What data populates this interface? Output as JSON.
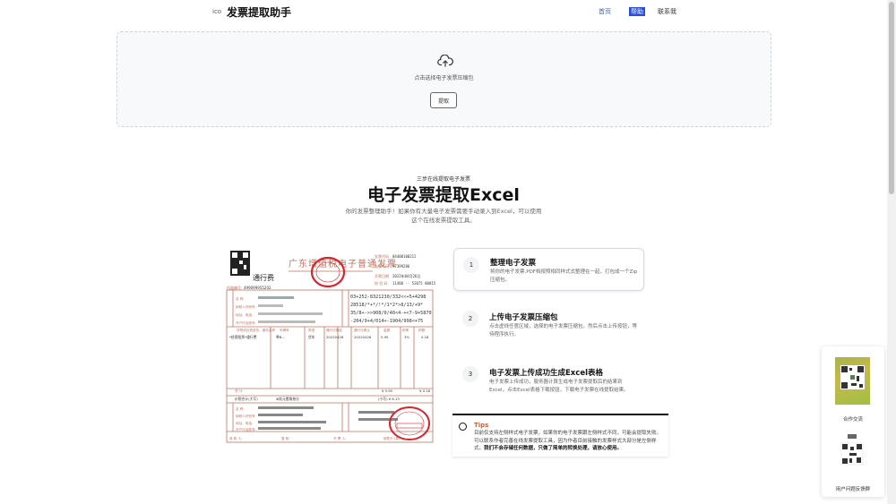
{
  "header": {
    "logo_icon": "ico",
    "title": "发票提取助手",
    "nav": [
      {
        "label": "首页"
      },
      {
        "label": "帮助"
      },
      {
        "label": "联系我"
      }
    ]
  },
  "upload": {
    "icon": "cloud-upload-icon",
    "hint": "点击选择电子发票压缩包",
    "button_label": "提取"
  },
  "hero": {
    "eyebrow": "三步在线提取电子发票",
    "title": "电子发票提取Excel",
    "desc": "你的发票整理助手！如果你有大量电子发票需要手动录入到Excel，可以使用这个在线发票提取工具。"
  },
  "invoice": {
    "title": "广东增值税电子普通发票",
    "kind": "通行费"
  },
  "steps": [
    {
      "num": "1",
      "title": "整理电子发票",
      "desc": "将你的电子发票.PDF档按照相同样式式整理在一起，打包成一个Zip压缩包。"
    },
    {
      "num": "2",
      "title": "上传电子发票压缩包",
      "desc": "点击虚线任意区域，选择的电子发票压缩包，然后点击上传按钮，等待程序执行。"
    },
    {
      "num": "3",
      "title": "电子发票上传成功生成Excel表格",
      "desc": "电子发票上传成功，服务器计算生成电子发票提取后的结果到Excel，点击Excel表格下载按钮，下载电子发票在线提取结果。"
    }
  ],
  "tips": {
    "title": "Tips",
    "body": "目前仅支持左侧样式电子发票，如果你的电子发票跟左侧样式不同，可能会提取失败。可以联系作者完善在线发票提取工具，因为作者目前接触的发票样式大部分是左侧样式。",
    "bold": "我们不会存储任何数据，只做了简单的转换处理，请放心使用。"
  },
  "float": {
    "label1": "合作交流",
    "label2": "用户问题反馈群"
  }
}
